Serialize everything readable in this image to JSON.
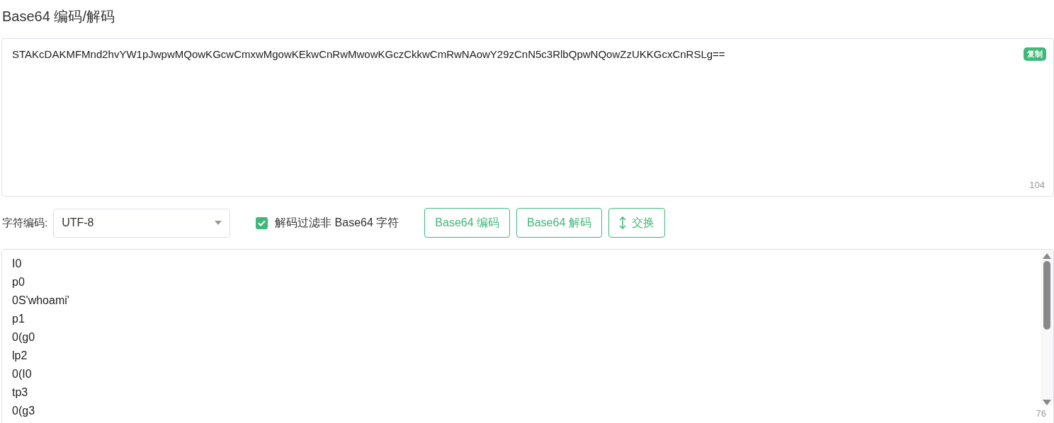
{
  "title": "Base64 编码/解码",
  "input": {
    "value": "STAKcDAKMFMnd2hvYW1pJwpwMQowKGcwCmxwMgowKEkwCnRwMwowKGczCkkwCmRwNAowY29zCnN5c3RlbQpwNQowZzUKKGcxCnRSLg==",
    "copy_label": "复制",
    "count": "104"
  },
  "controls": {
    "charset_label": "字符编码:",
    "charset": "UTF-8",
    "filter": {
      "label": "解码过滤非 Base64 字符",
      "checked": true
    },
    "buttons": [
      {
        "label": "Base64 编码",
        "kind": "text"
      },
      {
        "label": "Base64 解码",
        "kind": "text"
      },
      {
        "label": "交换",
        "kind": "swap"
      }
    ]
  },
  "output": {
    "lines": [
      "I0",
      "p0",
      "0S'whoami'",
      "p1",
      "0(g0",
      "lp2",
      "0(I0",
      "tp3",
      "0(g3"
    ],
    "count": "76"
  }
}
